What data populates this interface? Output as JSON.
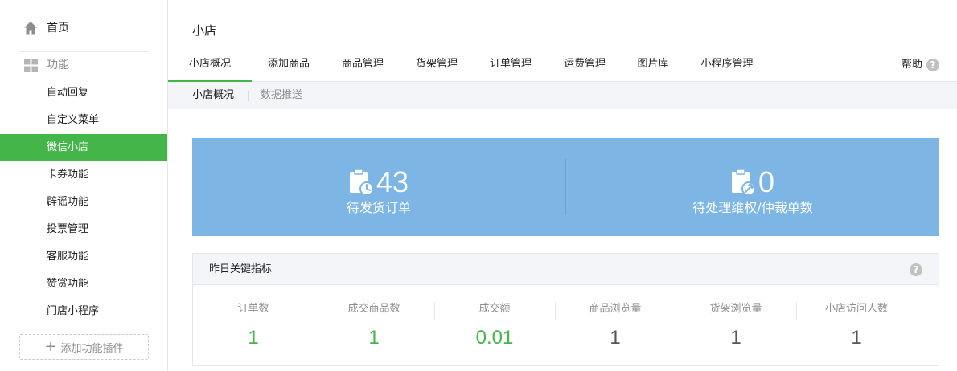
{
  "sidebar": {
    "home_label": "首页",
    "section_label": "功能",
    "items": [
      {
        "label": "自动回复",
        "active": false
      },
      {
        "label": "自定义菜单",
        "active": false
      },
      {
        "label": "微信小店",
        "active": true
      },
      {
        "label": "卡券功能",
        "active": false
      },
      {
        "label": "辟谣功能",
        "active": false
      },
      {
        "label": "投票管理",
        "active": false
      },
      {
        "label": "客服功能",
        "active": false
      },
      {
        "label": "赞赏功能",
        "active": false
      },
      {
        "label": "门店小程序",
        "active": false
      }
    ],
    "add_plugin_label": "添加功能插件"
  },
  "header": {
    "title": "小店",
    "help_label": "帮助"
  },
  "tabs": [
    {
      "label": "小店概况",
      "active": true
    },
    {
      "label": "添加商品",
      "active": false
    },
    {
      "label": "商品管理",
      "active": false
    },
    {
      "label": "货架管理",
      "active": false
    },
    {
      "label": "订单管理",
      "active": false
    },
    {
      "label": "运费管理",
      "active": false
    },
    {
      "label": "图片库",
      "active": false
    },
    {
      "label": "小程序管理",
      "active": false
    }
  ],
  "subtabs": [
    {
      "label": "小店概况",
      "active": true
    },
    {
      "label": "数据推送",
      "active": false
    }
  ],
  "stats": {
    "pending_shipment": {
      "value": "43",
      "label": "待发货订单",
      "icon": "clipboard-clock-icon"
    },
    "pending_dispute": {
      "value": "0",
      "label": "待处理维权/仲裁单数",
      "icon": "clipboard-gavel-icon"
    }
  },
  "metrics": {
    "title": "昨日关键指标",
    "items": [
      {
        "label": "订单数",
        "value": "1",
        "color": "#44b549"
      },
      {
        "label": "成交商品数",
        "value": "1",
        "color": "#44b549"
      },
      {
        "label": "成交额",
        "value": "0.01",
        "color": "#44b549"
      },
      {
        "label": "商品浏览量",
        "value": "1",
        "color": "#555555"
      },
      {
        "label": "货架浏览量",
        "value": "1",
        "color": "#555555"
      },
      {
        "label": "小店访问人数",
        "value": "1",
        "color": "#555555"
      }
    ]
  },
  "colors": {
    "accent": "#44b549",
    "banner": "#7db6e4"
  }
}
